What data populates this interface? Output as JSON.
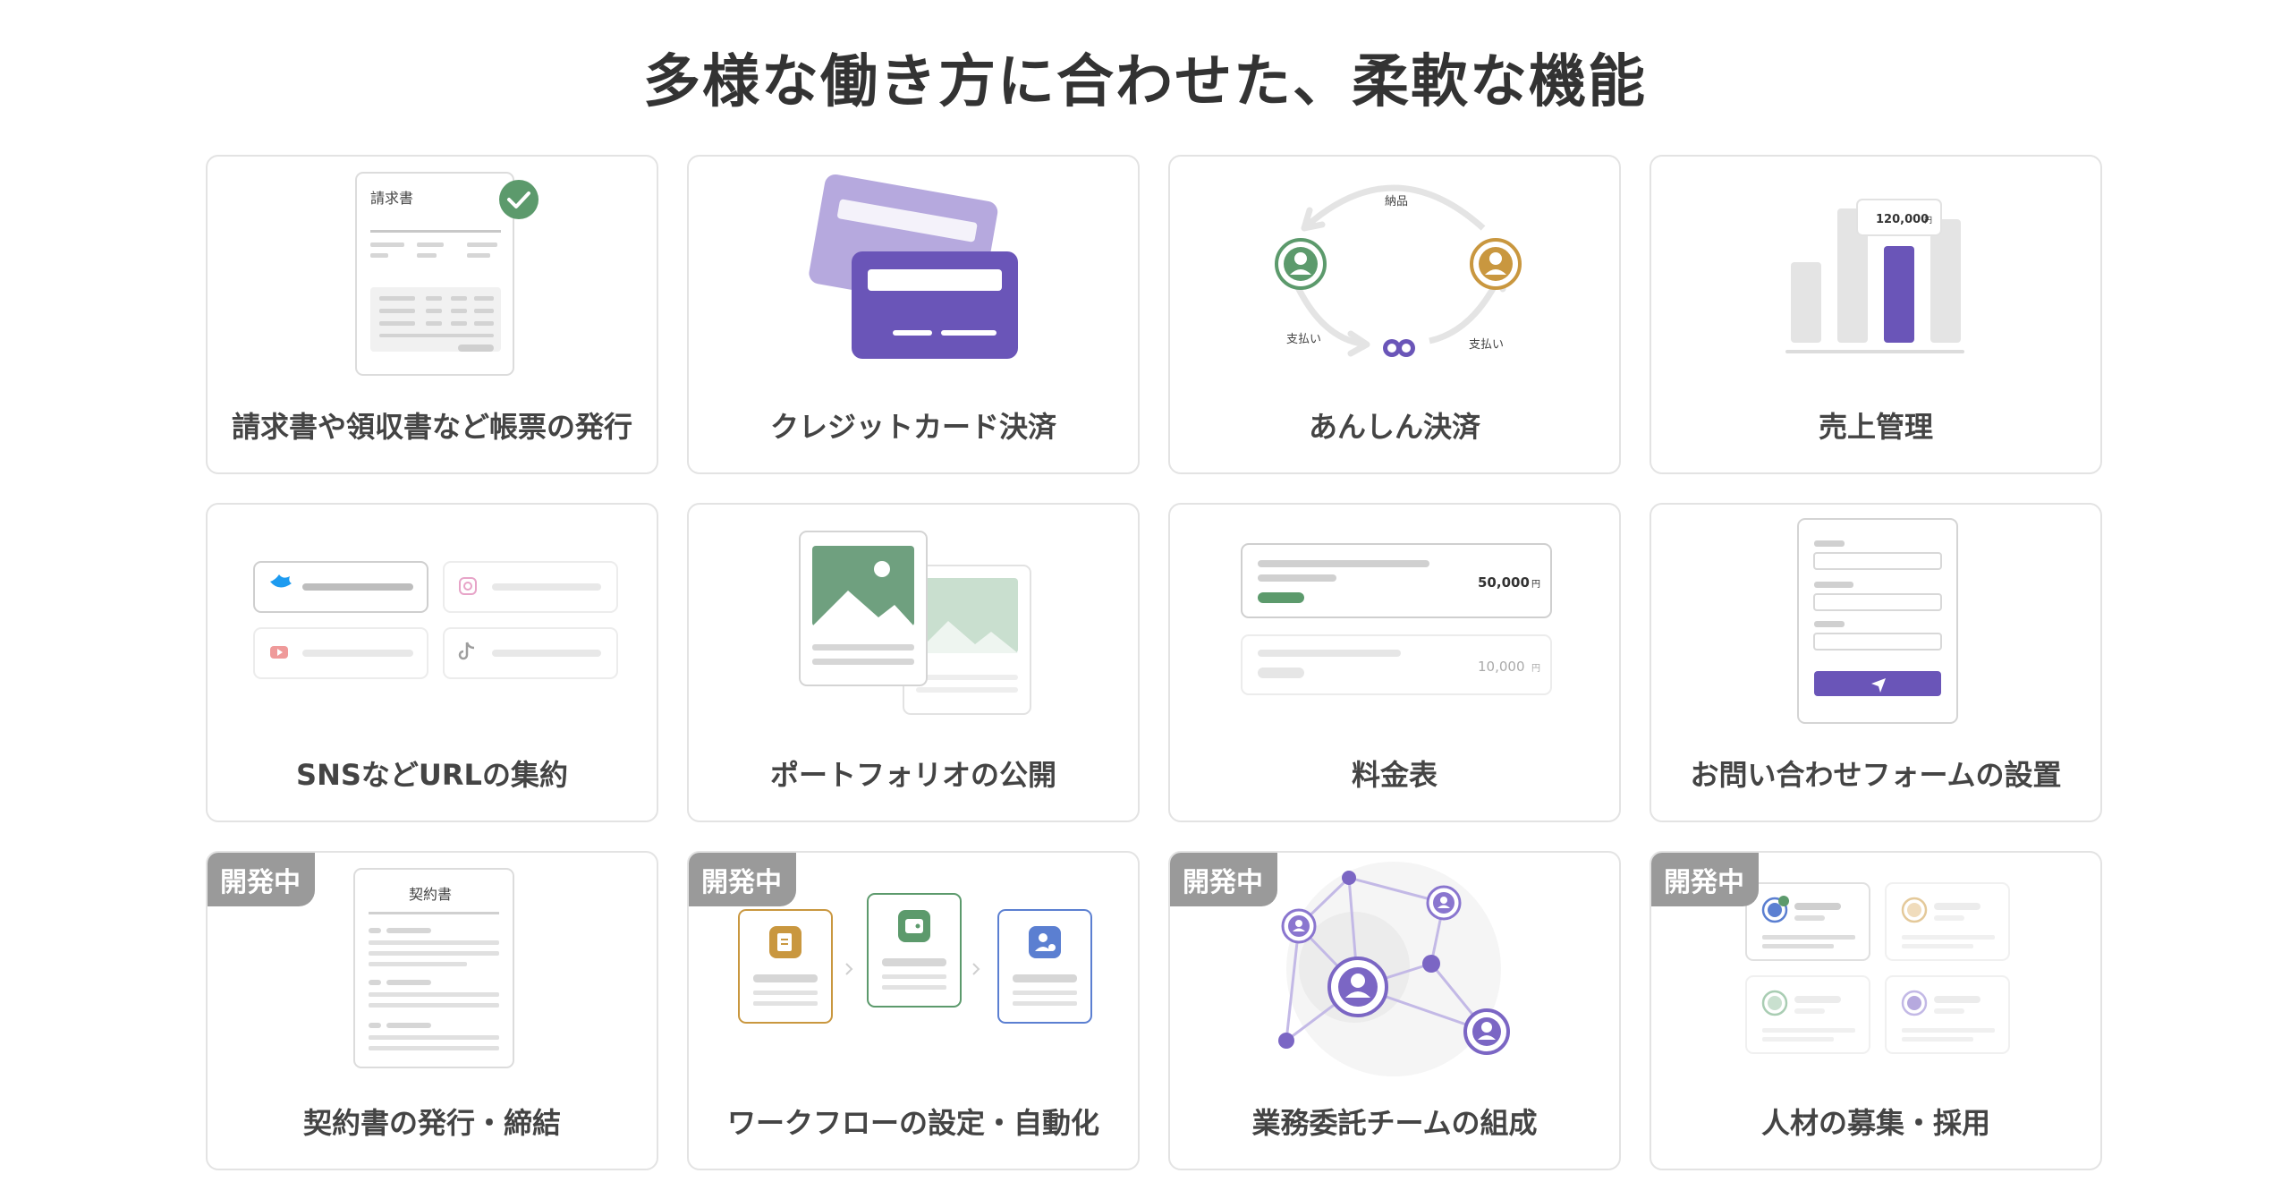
{
  "page_title": "多様な働き方に合わせた、柔軟な機能",
  "dev_badge": "開発中",
  "cards": [
    {
      "label": "請求書や領収書など帳票の発行",
      "illustration": {
        "doc_title": "請求書"
      }
    },
    {
      "label": "クレジットカード決済"
    },
    {
      "label": "あんしん決済",
      "illustration": {
        "delivery": "納品",
        "payment_left": "支払い",
        "payment_right": "支払い"
      }
    },
    {
      "label": "売上管理",
      "illustration": {
        "amount": "120,000",
        "unit": "円"
      }
    },
    {
      "label": "SNSなどURLの集約"
    },
    {
      "label": "ポートフォリオの公開"
    },
    {
      "label": "料金表",
      "illustration": {
        "price_1": "50,000",
        "price_2": "10,000",
        "unit": "円"
      }
    },
    {
      "label": "お問い合わせフォームの設置"
    },
    {
      "label": "契約書の発行・締結",
      "illustration": {
        "doc_title": "契約書"
      }
    },
    {
      "label": "ワークフローの設定・自動化"
    },
    {
      "label": "業務委託チームの組成"
    },
    {
      "label": "人材の募集・採用"
    }
  ],
  "colors": {
    "purple": "#6a55b8",
    "light_purple": "#b6a9de",
    "green": "#5c9a6c",
    "gold": "#c9973f",
    "blue": "#5b7fd1",
    "border": "#e3e3e3",
    "badge": "#9a9a9a"
  }
}
